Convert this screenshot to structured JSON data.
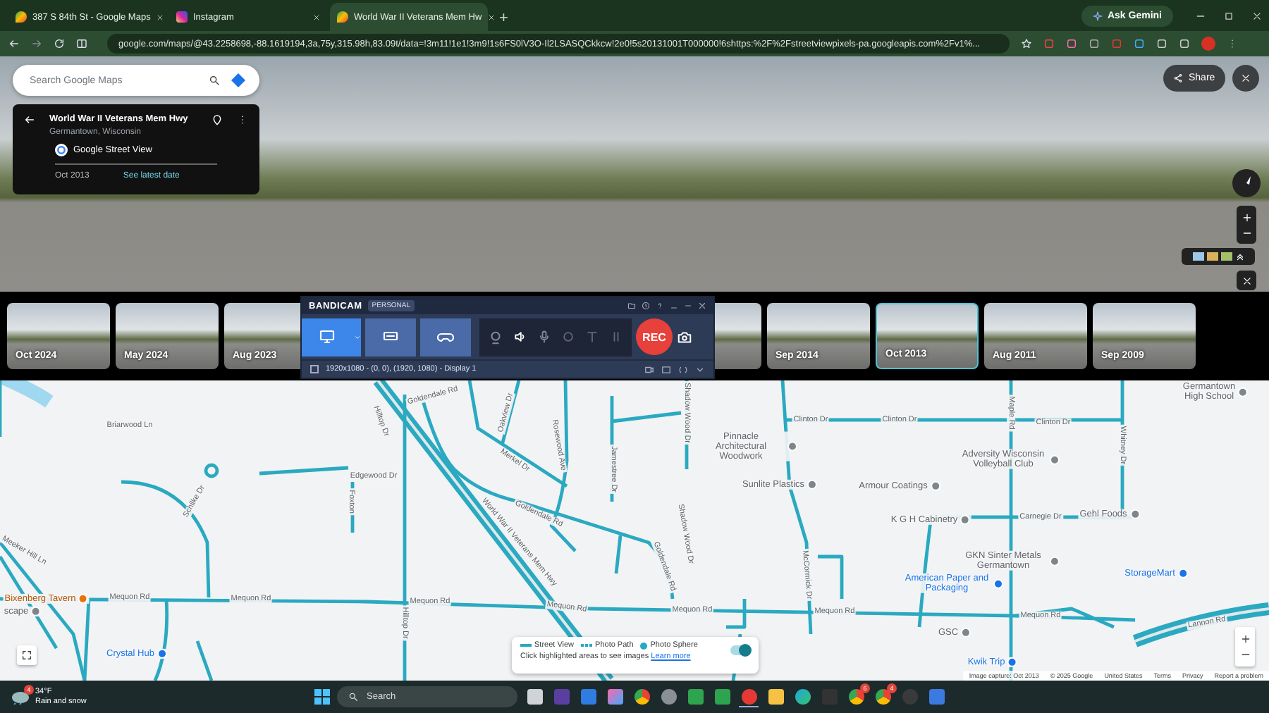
{
  "browser": {
    "tabs": [
      {
        "title": "387 S 84th St - Google Maps",
        "kind": "maps",
        "selected": false
      },
      {
        "title": "Instagram",
        "kind": "instagram",
        "selected": false
      },
      {
        "title": "World War II Veterans Mem Hw",
        "kind": "maps",
        "selected": true
      }
    ],
    "new_tab": "+",
    "gemini_button": "Ask Gemini",
    "url": "google.com/maps/@43.2258698,-88.1619194,3a,75y,315.98h,83.09t/data=!3m11!1e1!3m9!1s6FS0lV3O-Il2LSASQCkkcw!2e0!5s20131001T000000!6shttps:%2F%2Fstreetviewpixels-pa.googleapis.com%2Fv1%..."
  },
  "search": {
    "placeholder": "Search Google Maps"
  },
  "place_card": {
    "title": "World War II Veterans Mem Hwy",
    "subtitle": "Germantown, Wisconsin",
    "source": "Google Street View",
    "date": "Oct 2013",
    "link": "See latest date"
  },
  "share_button": "Share",
  "timeline": [
    {
      "label": "Oct 2024",
      "selected": false
    },
    {
      "label": "May 2024",
      "selected": false
    },
    {
      "label": "Aug 2023",
      "selected": false
    },
    {
      "selected": false
    },
    {
      "label": "Sep 2014",
      "selected": false
    },
    {
      "label": "Oct 2013",
      "selected": true
    },
    {
      "label": "Aug 2011",
      "selected": false
    },
    {
      "label": "Sep 2009",
      "selected": false
    }
  ],
  "recorder": {
    "logo": "BANDICAM",
    "edition": "PERSONAL",
    "modes": [
      {
        "kind": "screen",
        "selected": true
      },
      {
        "kind": "device",
        "selected": false
      },
      {
        "kind": "game",
        "selected": false
      }
    ],
    "record_button": "REC",
    "area_checked": false,
    "area": "1920x1080 - (0, 0), (1920, 1080) - Display 1"
  },
  "map": {
    "labels": [
      {
        "text": "Briarwood Ln",
        "kind": "road"
      },
      {
        "text": "Oakview Dr",
        "kind": "road"
      },
      {
        "text": "Merkel Dr",
        "kind": "road"
      },
      {
        "text": "Rosewood Ave",
        "kind": "road"
      },
      {
        "text": "Jamestree Dr",
        "kind": "road"
      },
      {
        "text": "Shadow Wood Dr",
        "kind": "road"
      },
      {
        "text": "Hilltop Dr",
        "kind": "road"
      },
      {
        "text": "Goldendale Rd",
        "kind": "road"
      },
      {
        "text": "World War II Veterans Mem Hwy",
        "kind": "road"
      },
      {
        "text": "Goldendale Rd",
        "kind": "road"
      },
      {
        "text": "Goldendale Rd",
        "kind": "road"
      },
      {
        "text": "Shadow Wood Dr",
        "kind": "road"
      },
      {
        "text": "Edgewood Dr",
        "kind": "road"
      },
      {
        "text": "Foxton",
        "kind": "road"
      },
      {
        "text": "Schilke Dr",
        "kind": "road"
      },
      {
        "text": "Meeker Hill Ln",
        "kind": "road"
      },
      {
        "text": "Mequon Rd",
        "kind": "road"
      },
      {
        "text": "Mequon Rd",
        "kind": "road"
      },
      {
        "text": "Mequon Rd",
        "kind": "road"
      },
      {
        "text": "Mequon Rd",
        "kind": "road"
      },
      {
        "text": "Mequon Rd",
        "kind": "road"
      },
      {
        "text": "Mequon Rd",
        "kind": "road"
      },
      {
        "text": "Mequon Rd",
        "kind": "road"
      },
      {
        "text": "Clinton Dr",
        "kind": "road"
      },
      {
        "text": "Clinton Dr",
        "kind": "road"
      },
      {
        "text": "Clinton Dr",
        "kind": "road"
      },
      {
        "text": "Maple Rd",
        "kind": "road"
      },
      {
        "text": "Whitney Dr",
        "kind": "road"
      },
      {
        "text": "Carnegie Dr",
        "kind": "road"
      },
      {
        "text": "McCormick Dr",
        "kind": "road"
      },
      {
        "text": "Lannon Rd",
        "kind": "road"
      },
      {
        "text": "Hilltop Dr",
        "kind": "road"
      },
      {
        "text": "Pinnacle Architectural Woodwork",
        "kind": "place"
      },
      {
        "text": "Sunlite Plastics",
        "kind": "place"
      },
      {
        "text": "Armour Coatings",
        "kind": "place"
      },
      {
        "text": "Adversity Wisconsin Volleyball Club",
        "kind": "place"
      },
      {
        "text": "K G H Cabinetry",
        "kind": "place"
      },
      {
        "text": "Gehl Foods",
        "kind": "place"
      },
      {
        "text": "GKN Sinter Metals Germantown",
        "kind": "place"
      },
      {
        "text": "American Paper and Packaging",
        "kind": "shop"
      },
      {
        "text": "StorageMart",
        "kind": "shop"
      },
      {
        "text": "Germantown High School",
        "kind": "place"
      },
      {
        "text": "Bixenberg Tavern",
        "kind": "food"
      },
      {
        "text": "Crystal Hub",
        "kind": "shop"
      },
      {
        "text": "GSC",
        "kind": "place"
      },
      {
        "text": "Kwik Trip",
        "kind": "shop"
      },
      {
        "text": "scape",
        "kind": "place"
      }
    ],
    "legend": {
      "items": [
        {
          "label": "Street View",
          "kind": "line"
        },
        {
          "label": "Photo Path",
          "kind": "dash"
        },
        {
          "label": "Photo Sphere",
          "kind": "dot"
        }
      ],
      "hint": "Click highlighted areas to see images",
      "link": "Learn more",
      "toggle_on": true
    },
    "attribution": [
      "Image capture: Oct 2013",
      "© 2025 Google",
      "United States",
      "Terms",
      "Privacy",
      "Report a problem"
    ]
  },
  "taskbar": {
    "weather": {
      "badge": "4",
      "temp": "34°F",
      "condition": "Rain and snow"
    },
    "search": "Search",
    "apps": [
      {
        "kind": "files"
      },
      {
        "kind": "purple"
      },
      {
        "kind": "store"
      },
      {
        "kind": "copilot"
      },
      {
        "kind": "chrome"
      },
      {
        "kind": "gray"
      },
      {
        "kind": "green"
      },
      {
        "kind": "green"
      },
      {
        "kind": "record",
        "active": true
      },
      {
        "kind": "folder"
      },
      {
        "kind": "edge"
      },
      {
        "kind": "dark"
      },
      {
        "kind": "chrome",
        "badge": "6"
      },
      {
        "kind": "chrome",
        "badge": "4"
      },
      {
        "kind": "play"
      },
      {
        "kind": "shield"
      }
    ]
  }
}
